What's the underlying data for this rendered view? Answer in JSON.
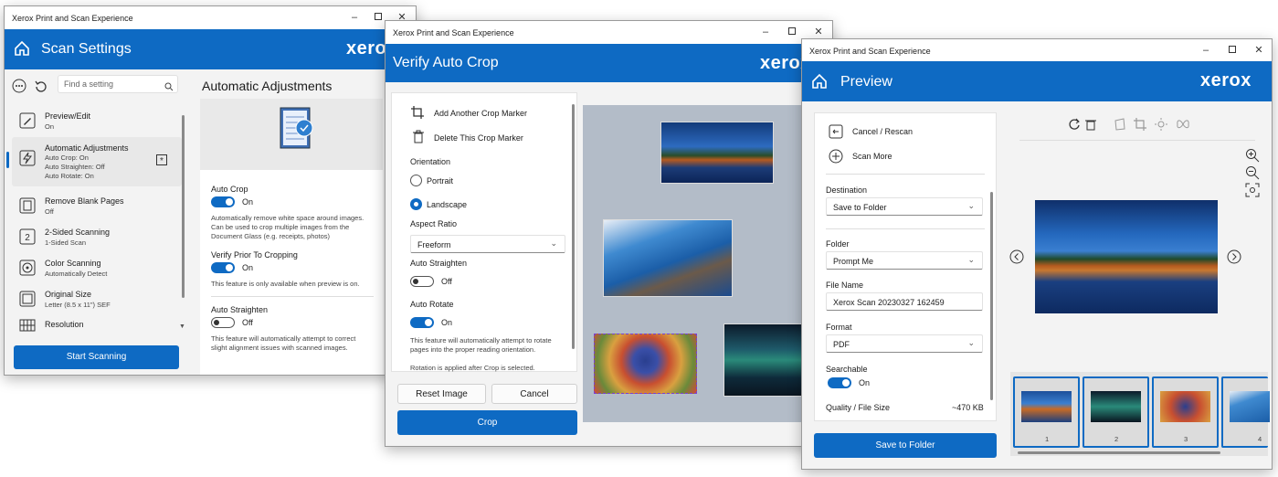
{
  "win1": {
    "title": "Xerox Print and Scan Experience",
    "header": "Scan Settings",
    "logo": "xerox",
    "search_placeholder": "Find a setting",
    "section_title": "Automatic Adjustments",
    "sidebar": [
      {
        "label": "Preview/Edit",
        "sub": "On",
        "icon": "edit-icon"
      },
      {
        "label": "Automatic Adjustments",
        "sub": "Auto Crop: On\nAuto Straighten: Off\nAuto Rotate: On",
        "icon": "lightning-icon"
      },
      {
        "label": "Remove Blank Pages",
        "sub": "Off",
        "icon": "blank-page-icon"
      },
      {
        "label": "2-Sided Scanning",
        "sub": "1-Sided Scan",
        "icon": "two-sided-icon"
      },
      {
        "label": "Color Scanning",
        "sub": "Automatically Detect",
        "icon": "palette-icon"
      },
      {
        "label": "Original Size",
        "sub": "Letter (8.5 x 11\") SEF",
        "icon": "page-size-icon"
      },
      {
        "label": "Resolution",
        "sub": "",
        "icon": "grid-icon"
      }
    ],
    "settings": {
      "auto_crop_label": "Auto Crop",
      "auto_crop_state": "On",
      "auto_crop_desc": "Automatically remove white space around images. Can be used to crop multiple images from the Document Glass (e.g. receipts, photos)",
      "verify_label": "Verify Prior To Cropping",
      "verify_state": "On",
      "verify_desc": "This feature is only available when preview is on.",
      "straighten_label": "Auto Straighten",
      "straighten_state": "Off",
      "straighten_desc": "This feature will automatically attempt to correct slight alignment issues with scanned images."
    },
    "start_button": "Start Scanning"
  },
  "win2": {
    "title": "Xerox Print and Scan Experience",
    "header": "Verify Auto Crop",
    "logo": "xerox",
    "add_marker": "Add Another Crop Marker",
    "delete_marker": "Delete This Crop Marker",
    "orientation_label": "Orientation",
    "portrait": "Portrait",
    "landscape": "Landscape",
    "aspect_label": "Aspect Ratio",
    "aspect_value": "Freeform",
    "straighten_label": "Auto Straighten",
    "straighten_state": "Off",
    "rotate_label": "Auto Rotate",
    "rotate_state": "On",
    "rotate_desc": "This feature will automatically attempt to rotate pages into the proper reading orientation.",
    "rotation_note": "Rotation is applied after Crop is selected.",
    "reset_button": "Reset Image",
    "cancel_button": "Cancel",
    "crop_button": "Crop"
  },
  "win3": {
    "title": "Xerox Print and Scan Experience",
    "header": "Preview",
    "logo": "xerox",
    "cancel_rescan": "Cancel / Rescan",
    "scan_more": "Scan More",
    "destination_label": "Destination",
    "destination_value": "Save to Folder",
    "folder_label": "Folder",
    "folder_value": "Prompt Me",
    "filename_label": "File Name",
    "filename_value": "Xerox Scan 20230327 162459",
    "format_label": "Format",
    "format_value": "PDF",
    "searchable_label": "Searchable",
    "searchable_state": "On",
    "quality_label": "Quality / File Size",
    "quality_value": "~470 KB",
    "save_button": "Save to Folder",
    "thumbnails": [
      "1",
      "2",
      "3",
      "4"
    ]
  },
  "colors": {
    "accent": "#0e6ac3",
    "window_bg": "#f3f3f3"
  }
}
